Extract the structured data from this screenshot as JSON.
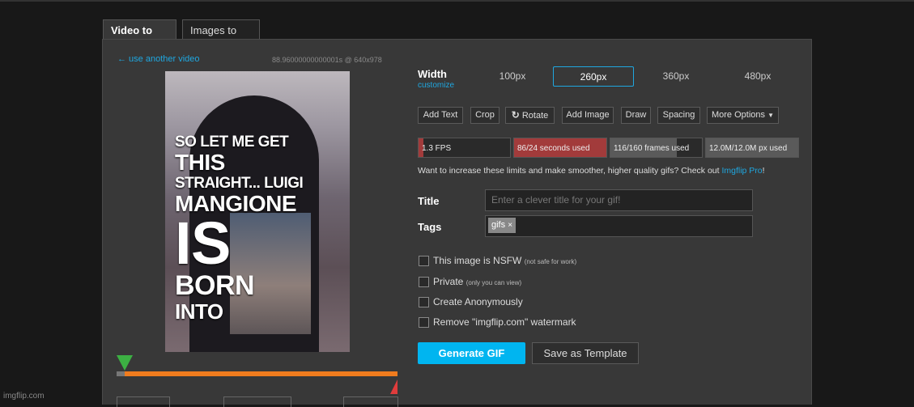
{
  "tabs": [
    {
      "label": "Video to GIF",
      "active": true
    },
    {
      "label": "Images to GIF",
      "active": false
    }
  ],
  "video": {
    "back_link": "← use another video",
    "meta": "88.96000000000001s @ 640x978",
    "caption_lines": [
      "SO LET ME GET",
      "THIS",
      "STRAIGHT... LUIGI",
      "MANGIONE",
      "IS",
      "BORN",
      "INTO"
    ],
    "trim_start_fraction": 0.0,
    "trim_end_fraction": 1.0
  },
  "width": {
    "label": "Width",
    "customize": "customize",
    "options": [
      "100px",
      "260px",
      "360px",
      "480px"
    ],
    "selected": "260px"
  },
  "toolbar": {
    "add_text": "Add Text",
    "crop": "Crop",
    "rotate": "Rotate",
    "add_image": "Add Image",
    "draw": "Draw",
    "spacing": "Spacing",
    "more_options": "More Options"
  },
  "stats": {
    "fps": {
      "text": "1.3 FPS",
      "fraction": 0.05
    },
    "seconds": {
      "text": "86/24 seconds used",
      "fraction": 1.0
    },
    "frames": {
      "text": "116/160 frames used",
      "fraction": 0.725
    },
    "pixels": {
      "text": "12.0M/12.0M px used",
      "fraction": 1.0
    }
  },
  "limits": {
    "text": "Want to increase these limits and make smoother, higher quality gifs? Check out ",
    "link": "Imgflip Pro",
    "suffix": "!"
  },
  "form": {
    "title_label": "Title",
    "title_placeholder": "Enter a clever title for your gif!",
    "tags_label": "Tags",
    "tags": [
      "gifs"
    ]
  },
  "checkboxes": [
    {
      "label": "This image is NSFW",
      "note": "(not safe for work)",
      "checked": false
    },
    {
      "label": "Private",
      "note": "(only you can view)",
      "checked": false
    },
    {
      "label": "Create Anonymously",
      "note": "",
      "checked": false
    },
    {
      "label": "Remove \"imgflip.com\" watermark",
      "note": "",
      "checked": false
    }
  ],
  "actions": {
    "generate": "Generate GIF",
    "template": "Save as Template"
  },
  "colors": {
    "accent": "#1fa7e0",
    "generate_bg": "#00b5f0",
    "trim_bar": "#f07c1e",
    "start_marker": "#3cb043",
    "end_marker": "#e03c3c",
    "over_limit": "#a23b3b"
  },
  "footer": {
    "watermark": "imgflip.com"
  }
}
